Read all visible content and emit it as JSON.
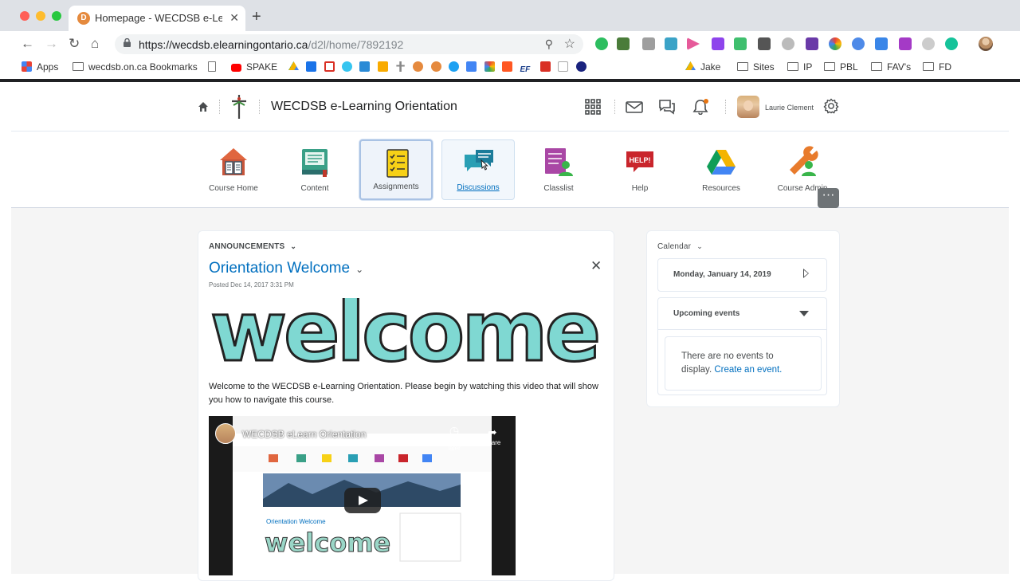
{
  "browser": {
    "tab_title": "Homepage - WECDSB e-Learni",
    "tab_favicon_letter": "D",
    "url_host": "https://wecdsb.elearningontario.ca",
    "url_path": "/d2l/home/7892192",
    "colors": {
      "close": "#ff5f57",
      "minimize": "#febc2e",
      "maximize": "#28c840"
    }
  },
  "bookmarks": [
    {
      "label": "Apps",
      "icon": "apps-grid-icon"
    },
    {
      "label": "wecdsb.on.ca Bookmarks",
      "icon": "folder-icon"
    },
    {
      "label": "",
      "icon": "document-icon"
    },
    {
      "label": "SPAKE",
      "icon": "youtube-icon"
    },
    {
      "label": "Jake",
      "icon": "drive-icon"
    },
    {
      "label": "Sites",
      "icon": "folder-icon"
    },
    {
      "label": "IP",
      "icon": "folder-icon"
    },
    {
      "label": "PBL",
      "icon": "folder-icon"
    },
    {
      "label": "FAV's",
      "icon": "folder-icon"
    },
    {
      "label": "FD",
      "icon": "folder-icon"
    }
  ],
  "minibar": {
    "course_title": "WECDSB e-Learning Orientation",
    "user_name": "Laurie Clement",
    "icons": [
      "home-icon",
      "course-logo-icon",
      "waffle-icon",
      "mail-icon",
      "chat-icon",
      "bell-icon",
      "gear-icon"
    ],
    "notification_color": "#e87511"
  },
  "navbar": {
    "items": [
      {
        "label": "Course Home",
        "icon": "house-book-icon"
      },
      {
        "label": "Content",
        "icon": "book-icon"
      },
      {
        "label": "Assignments",
        "icon": "checklist-icon"
      },
      {
        "label": "Discussions",
        "icon": "chat-bubbles-icon"
      },
      {
        "label": "Classlist",
        "icon": "classlist-icon"
      },
      {
        "label": "Help",
        "icon": "help-bubble-icon"
      },
      {
        "label": "Resources",
        "icon": "drive-icon"
      },
      {
        "label": "Course Admin",
        "icon": "admin-wrench-icon"
      }
    ],
    "more": "···"
  },
  "announcements": {
    "header": "ANNOUNCEMENTS",
    "title": "Orientation Welcome",
    "posted": "Posted Dec 14, 2017 3:31 PM",
    "banner_text": "welcome",
    "body": "Welcome to the WECDSB e-Learning Orientation.  Please begin by watching this video that will show you how to navigate this course.",
    "video": {
      "title": "WECDSB eLearn Orientation",
      "watch_later": "Watch later",
      "share": "Share"
    }
  },
  "calendar": {
    "header": "Calendar",
    "date": "Monday, January 14, 2019",
    "upcoming_label": "Upcoming events",
    "no_events": "There are no events to display.",
    "create_link": "Create an event."
  }
}
